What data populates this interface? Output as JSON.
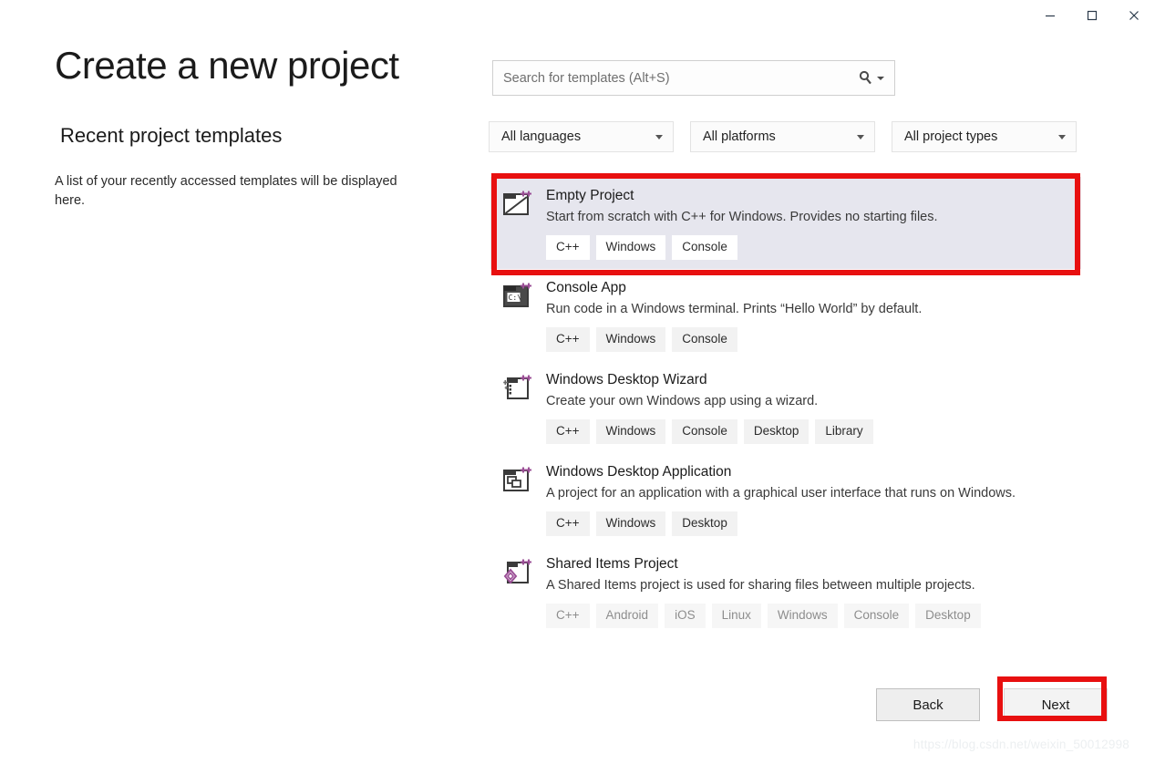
{
  "window": {
    "controls": [
      {
        "name": "minimize",
        "label": "—"
      },
      {
        "name": "maximize",
        "label": "☐"
      },
      {
        "name": "close",
        "label": "✕"
      }
    ]
  },
  "left": {
    "title": "Create a new project",
    "recent_heading": "Recent project templates",
    "recent_body": "A list of your recently accessed templates will be displayed here."
  },
  "search": {
    "placeholder": "Search for templates (Alt+S)",
    "value": "",
    "icon": "search-icon"
  },
  "filters": [
    {
      "name": "language",
      "value": "All languages"
    },
    {
      "name": "platform",
      "value": "All platforms"
    },
    {
      "name": "project-type",
      "value": "All project types"
    }
  ],
  "templates": [
    {
      "name": "Empty Project",
      "description": "Start from scratch with C++ for Windows. Provides no starting files.",
      "tags": [
        "C++",
        "Windows",
        "Console"
      ],
      "selected": true,
      "muted": false,
      "icon": "empty-project-icon"
    },
    {
      "name": "Console App",
      "description": "Run code in a Windows terminal. Prints “Hello World” by default.",
      "tags": [
        "C++",
        "Windows",
        "Console"
      ],
      "selected": false,
      "muted": false,
      "icon": "console-app-icon"
    },
    {
      "name": "Windows Desktop Wizard",
      "description": "Create your own Windows app using a wizard.",
      "tags": [
        "C++",
        "Windows",
        "Console",
        "Desktop",
        "Library"
      ],
      "selected": false,
      "muted": false,
      "icon": "desktop-wizard-icon"
    },
    {
      "name": "Windows Desktop Application",
      "description": "A project for an application with a graphical user interface that runs on Windows.",
      "tags": [
        "C++",
        "Windows",
        "Desktop"
      ],
      "selected": false,
      "muted": false,
      "icon": "desktop-application-icon"
    },
    {
      "name": "Shared Items Project",
      "description": "A Shared Items project is used for sharing files between multiple projects.",
      "tags": [
        "C++",
        "Android",
        "iOS",
        "Linux",
        "Windows",
        "Console",
        "Desktop"
      ],
      "selected": false,
      "muted": true,
      "icon": "shared-items-icon"
    }
  ],
  "footer": {
    "back_label": "Back",
    "next_label": "Next"
  },
  "annotations": {
    "color": "#e81010",
    "targets": [
      "Empty Project",
      "Next"
    ]
  },
  "watermark": "https://blog.csdn.net/weixin_50012998"
}
